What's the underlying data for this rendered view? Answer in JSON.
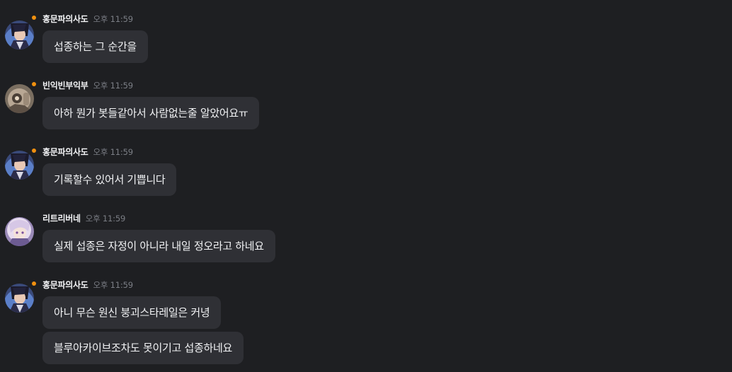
{
  "messages": [
    {
      "username": "홍문파의사도",
      "time": "오후 11:59",
      "avatar": "avatar-sage",
      "bubbles": [
        "섭종하는 그 순간을"
      ]
    },
    {
      "username": "빈익빈부익부",
      "time": "오후 11:59",
      "avatar": "avatar-robot",
      "bubbles": [
        "아하 뭔가 봇들같아서 사람없는줄 알았어요ㅠ"
      ]
    },
    {
      "username": "홍문파의사도",
      "time": "오후 11:59",
      "avatar": "avatar-sage",
      "bubbles": [
        "기록할수 있어서 기쁩니다"
      ]
    },
    {
      "username": "리트리버네",
      "time": "오후 11:59",
      "avatar": "avatar-girl",
      "bubbles": [
        "실제 섭종은 자정이 아니라 내일 정오라고 하네요"
      ]
    },
    {
      "username": "홍문파의사도",
      "time": "오후 11:59",
      "avatar": "avatar-sage",
      "bubbles": [
        "아니 무슨 원신 붕괴스타레일은 커녕",
        "블루아카이브조차도 못이기고 섭종하네요"
      ]
    }
  ],
  "colors": {
    "background": "#1e1f22",
    "bubble": "#2f3035",
    "status_dot": "#f0900f",
    "timestamp": "#7b7e85"
  }
}
